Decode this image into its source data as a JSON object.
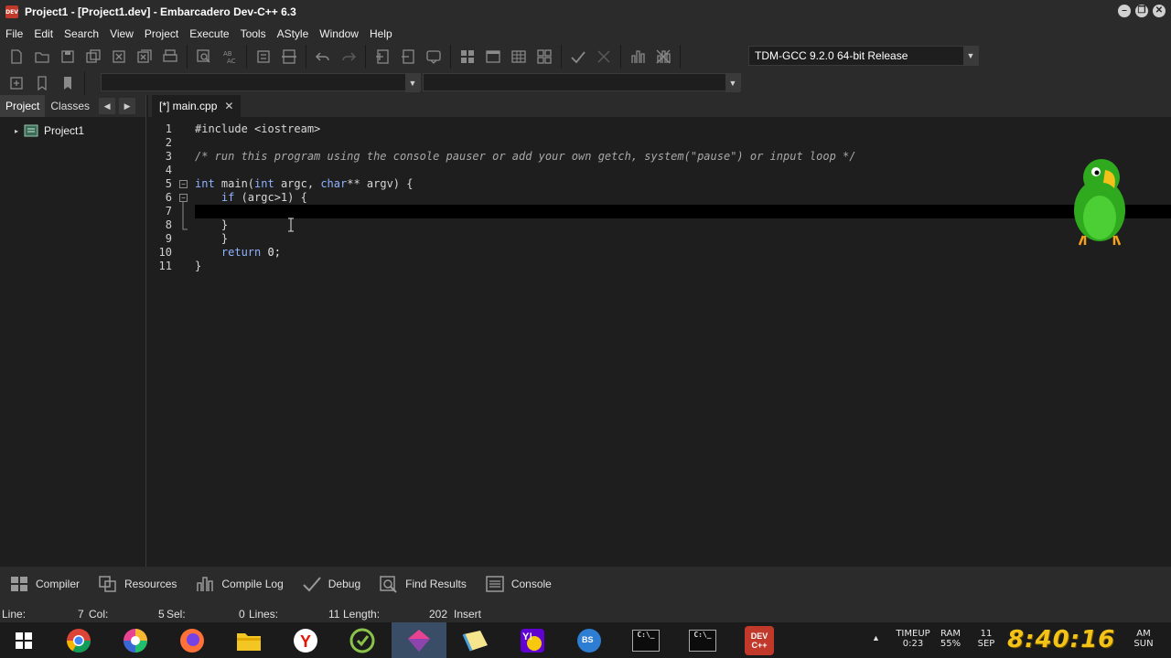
{
  "window": {
    "app_icon": "DEV",
    "title": "Project1 - [Project1.dev] - Embarcadero Dev-C++ 6.3",
    "buttons": [
      "minimize-icon",
      "restore-icon",
      "close-icon"
    ]
  },
  "menu": [
    "File",
    "Edit",
    "Search",
    "View",
    "Project",
    "Execute",
    "Tools",
    "AStyle",
    "Window",
    "Help"
  ],
  "toolbar": {
    "compiler_value": "TDM-GCC 9.2.0 64-bit Release"
  },
  "left_panel": {
    "tabs": [
      "Project",
      "Classes"
    ],
    "tree_root": "Project1"
  },
  "editor": {
    "tab_label": "[*] main.cpp",
    "line_numbers": [
      "1",
      "2",
      "3",
      "4",
      "5",
      "6",
      "7",
      "8",
      "9",
      "10",
      "11"
    ],
    "current_line": 7
  },
  "code": {
    "l1": "#include <iostream>",
    "l3": "/* run this program using the console pauser or add your own getch, system(\"pause\") or input loop */",
    "l5_kw1": "int",
    "l5_a": " main(",
    "l5_kw2": "int",
    "l5_b": " argc, ",
    "l5_kw3": "char",
    "l5_c": "** argv) {",
    "l6_kw": "if",
    "l6_a": " (argc>1) {",
    "l8": "    }",
    "l9": "    }",
    "l10_kw": "return",
    "l10_a": " 0;",
    "l11": "}"
  },
  "bottom_tabs": [
    "Compiler",
    "Resources",
    "Compile Log",
    "Debug",
    "Find Results",
    "Console"
  ],
  "status": {
    "line_label": "Line:",
    "line_value": "7",
    "col_label": "Col:",
    "col_value": "5",
    "sel_label": "Sel:",
    "sel_value": "0",
    "lines_label": "Lines:",
    "lines_value": "11",
    "length_label": "Length:",
    "length_value": "202",
    "mode": "Insert"
  },
  "taskbar": {
    "dev_icon": "DEV\nC++",
    "cmd_label": "C:\\_",
    "bs_label": "BS",
    "timeup_label": "TIMEUP",
    "timeup_value": "0:23",
    "ram_label": "RAM",
    "ram_value": "55%",
    "date_day": "11",
    "date_month": "SEP",
    "clock": "8:40:16",
    "ampm": "AM",
    "weekday": "SUN"
  }
}
